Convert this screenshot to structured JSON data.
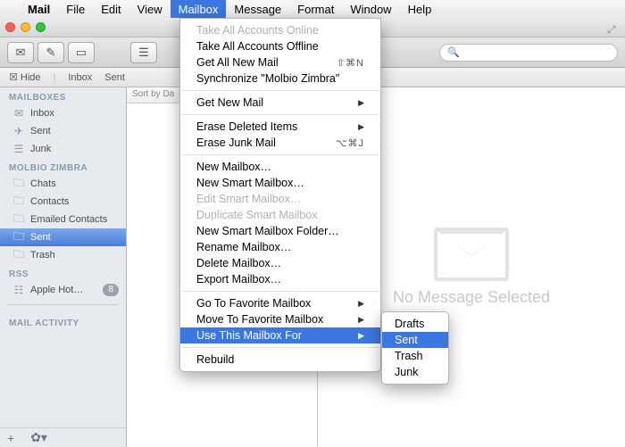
{
  "menubar": {
    "app": "Mail",
    "items": [
      "File",
      "Edit",
      "View",
      "Mailbox",
      "Message",
      "Format",
      "Window",
      "Help"
    ],
    "active_index": 3
  },
  "favbar": {
    "hide": "Hide",
    "inbox": "Inbox",
    "sent": "Sent"
  },
  "search": {
    "placeholder": ""
  },
  "sidebar": {
    "sections": [
      {
        "title": "Mailboxes",
        "items": [
          {
            "label": "Inbox",
            "icon": "inbox"
          },
          {
            "label": "Sent",
            "icon": "sent"
          },
          {
            "label": "Junk",
            "icon": "junk"
          }
        ]
      },
      {
        "title": "Molbio Zimbra",
        "items": [
          {
            "label": "Chats",
            "icon": "folder"
          },
          {
            "label": "Contacts",
            "icon": "folder"
          },
          {
            "label": "Emailed Contacts",
            "icon": "folder"
          },
          {
            "label": "Sent",
            "icon": "folder",
            "selected": true
          },
          {
            "label": "Trash",
            "icon": "folder"
          }
        ]
      },
      {
        "title": "RSS",
        "items": [
          {
            "label": "Apple Hot…",
            "icon": "rss",
            "badge": "8"
          }
        ]
      },
      {
        "title": "Mail Activity",
        "items": []
      }
    ]
  },
  "list": {
    "sort_header": "Sort by Da"
  },
  "content": {
    "no_message": "No Message Selected"
  },
  "menu": {
    "groups": [
      [
        {
          "label": "Take All Accounts Online",
          "disabled": true
        },
        {
          "label": "Take All Accounts Offline"
        },
        {
          "label": "Get All New Mail",
          "shortcut": "⇧⌘N"
        },
        {
          "label": "Synchronize \"Molbio Zimbra\""
        }
      ],
      [
        {
          "label": "Get New Mail",
          "submenu": true
        }
      ],
      [
        {
          "label": "Erase Deleted Items",
          "submenu": true
        },
        {
          "label": "Erase Junk Mail",
          "shortcut": "⌥⌘J"
        }
      ],
      [
        {
          "label": "New Mailbox…"
        },
        {
          "label": "New Smart Mailbox…"
        },
        {
          "label": "Edit Smart Mailbox…",
          "disabled": true
        },
        {
          "label": "Duplicate Smart Mailbox",
          "disabled": true
        },
        {
          "label": "New Smart Mailbox Folder…"
        },
        {
          "label": "Rename Mailbox…"
        },
        {
          "label": "Delete Mailbox…"
        },
        {
          "label": "Export Mailbox…"
        }
      ],
      [
        {
          "label": "Go To Favorite Mailbox",
          "submenu": true
        },
        {
          "label": "Move To Favorite Mailbox",
          "submenu": true
        },
        {
          "label": "Use This Mailbox For",
          "submenu": true,
          "highlight": true
        }
      ],
      [
        {
          "label": "Rebuild"
        }
      ]
    ],
    "submenu": [
      "Drafts",
      "Sent",
      "Trash",
      "Junk"
    ],
    "submenu_highlight": 1
  }
}
